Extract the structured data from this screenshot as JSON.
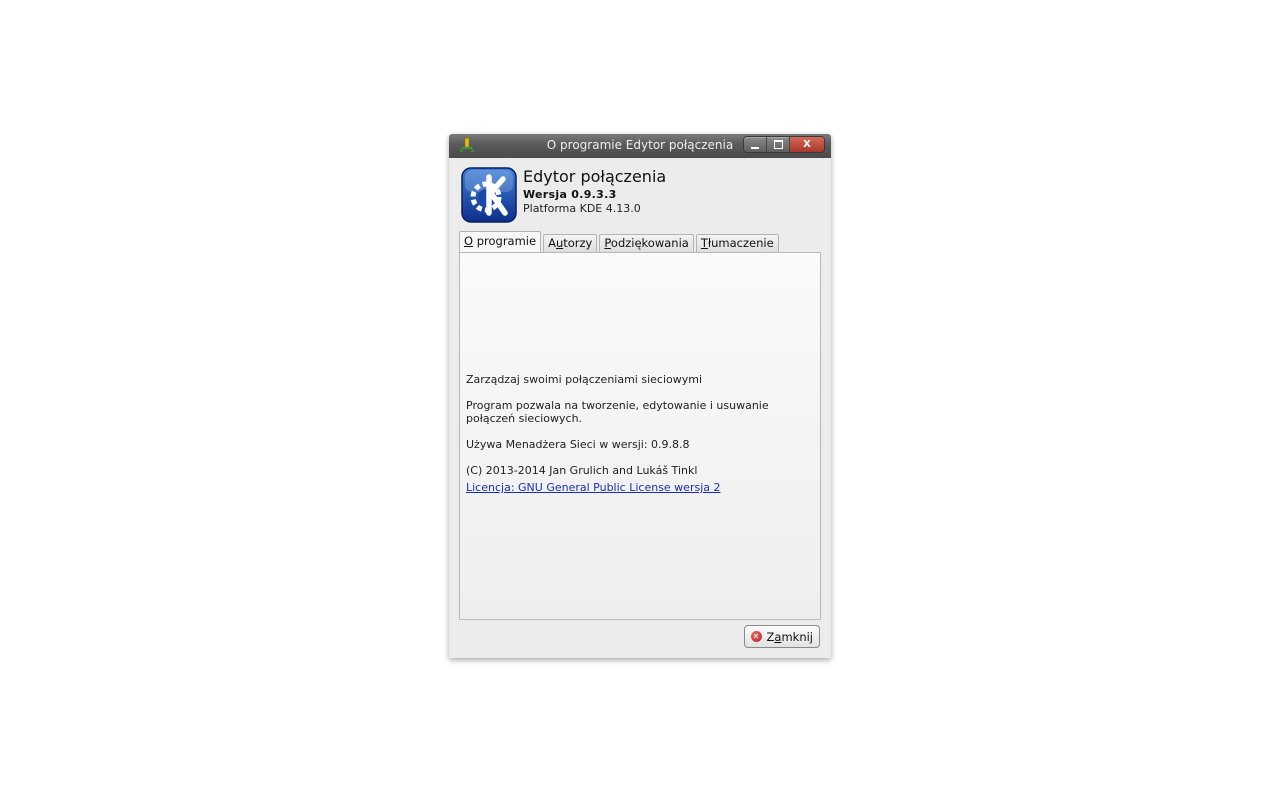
{
  "window": {
    "title": "O programie Edytor połączenia",
    "close_glyph": "X"
  },
  "header": {
    "app_name": "Edytor połączenia",
    "version": "Wersja 0.9.3.3",
    "platform": "Platforma KDE 4.13.0",
    "logo_icon": "kde-logo-icon"
  },
  "tabs": [
    {
      "mnemonic": "O",
      "rest": " programie",
      "active": true
    },
    {
      "pre": "A",
      "mnemonic": "u",
      "rest": "torzy",
      "active": false
    },
    {
      "mnemonic": "P",
      "rest": "odziękowania",
      "active": false
    },
    {
      "mnemonic": "T",
      "rest": "łumaczenie",
      "active": false
    }
  ],
  "about": {
    "short_description": "Zarządzaj swoimi połączeniami sieciowymi",
    "long_description": "Program pozwala na tworzenie, edytowanie i usuwanie połączeń sieciowych.",
    "network_manager_version": "Używa Menadżera Sieci w wersji: 0.9.8.8",
    "copyright": "(C) 2013-2014 Jan Grulich and Lukáš Tinkl",
    "license_link": "Licencja: GNU General Public License wersja 2"
  },
  "close_button": {
    "pre": "Z",
    "mnemonic": "a",
    "rest": "mknij"
  },
  "colors": {
    "link": "#1a2fb3",
    "titlebar": "#5a5a5a",
    "close_icon": "#b81a1a"
  }
}
